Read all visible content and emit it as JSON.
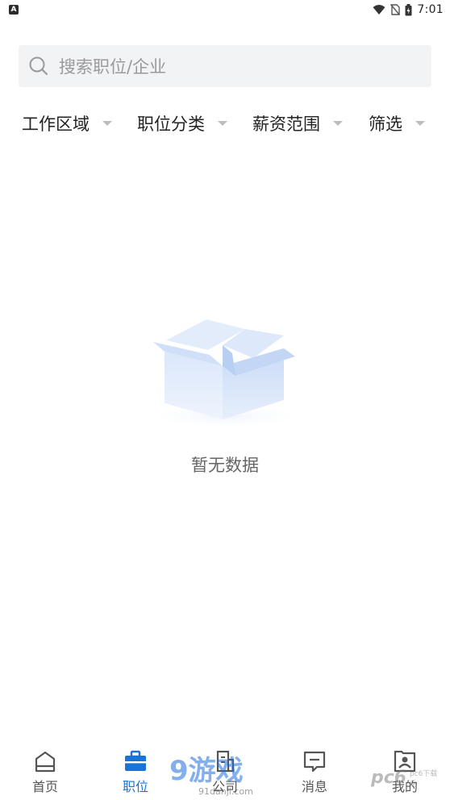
{
  "status_bar": {
    "left_icon": "A",
    "time": "7:01",
    "icons": [
      "wifi-icon",
      "no-sim-icon",
      "battery-charging-icon"
    ]
  },
  "search": {
    "placeholder": "搜索职位/企业",
    "icon": "search-icon"
  },
  "filters": [
    {
      "label": "工作区域"
    },
    {
      "label": "职位分类"
    },
    {
      "label": "薪资范围"
    },
    {
      "label": "筛选"
    }
  ],
  "empty_state": {
    "illustration": "empty-box-icon",
    "text": "暂无数据"
  },
  "bottom_nav": {
    "items": [
      {
        "label": "首页",
        "icon": "home-icon",
        "active": false
      },
      {
        "label": "职位",
        "icon": "briefcase-icon",
        "active": true
      },
      {
        "label": "公司",
        "icon": "building-icon",
        "active": false
      },
      {
        "label": "消息",
        "icon": "message-icon",
        "active": false
      },
      {
        "label": "我的",
        "icon": "profile-icon",
        "active": false
      }
    ]
  },
  "watermarks": {
    "center": "9",
    "center_cn": "游戏",
    "center_url": "91danji.com",
    "right": "pc6",
    "right_small": "pc6下载站"
  },
  "colors": {
    "accent": "#1a73d9",
    "search_bg": "#f2f3f5",
    "text_primary": "#222222",
    "text_secondary": "#666666"
  }
}
